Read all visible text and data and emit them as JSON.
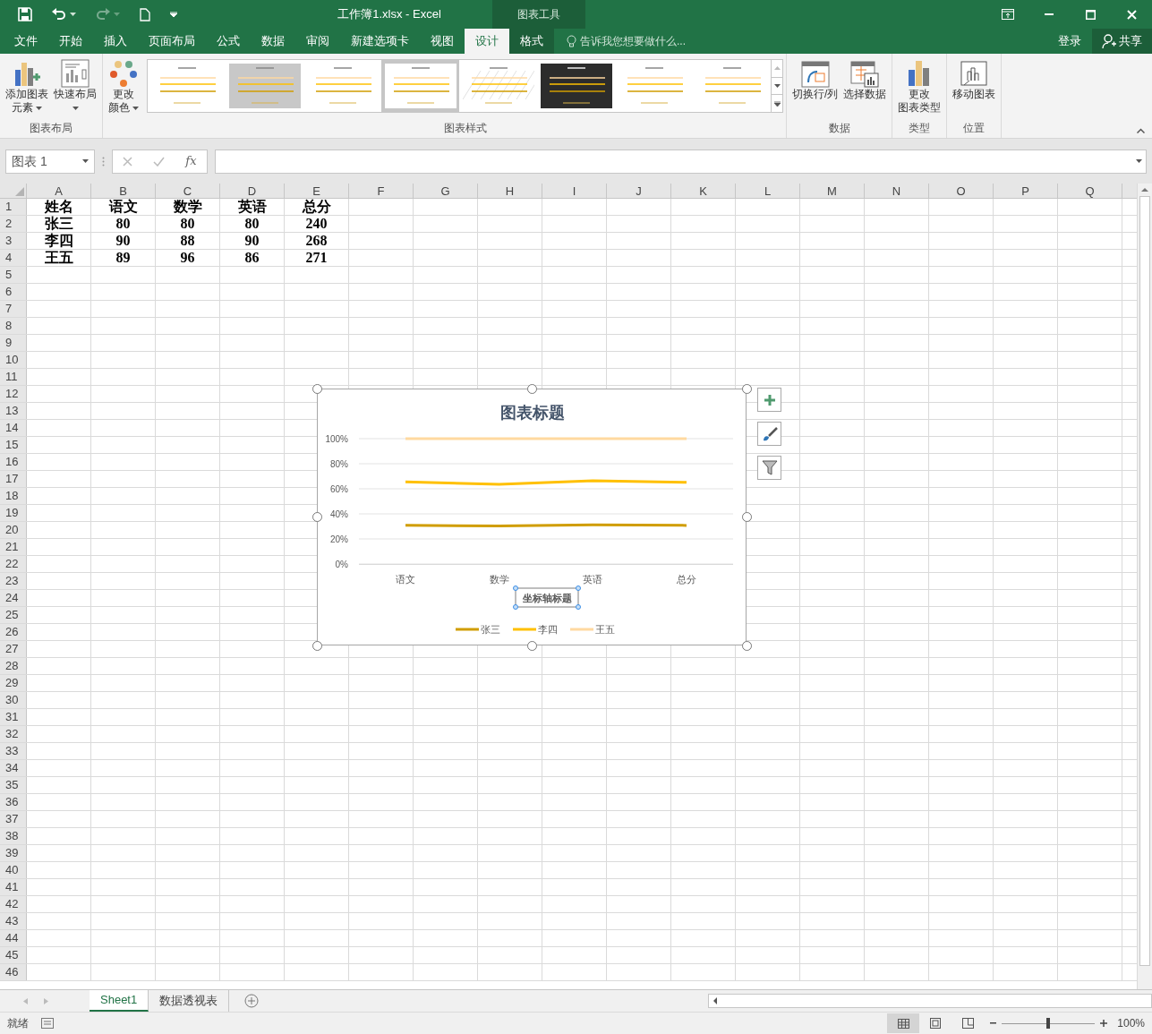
{
  "window": {
    "title": "工作簿1.xlsx - Excel",
    "context_group": "图表工具"
  },
  "ribbon_tabs": [
    {
      "label": "文件",
      "selected": false
    },
    {
      "label": "开始",
      "selected": false
    },
    {
      "label": "插入",
      "selected": false
    },
    {
      "label": "页面布局",
      "selected": false
    },
    {
      "label": "公式",
      "selected": false
    },
    {
      "label": "数据",
      "selected": false
    },
    {
      "label": "审阅",
      "selected": false
    },
    {
      "label": "新建选项卡",
      "selected": false
    },
    {
      "label": "视图",
      "selected": false
    },
    {
      "label": "设计",
      "selected": true,
      "kind": "context"
    },
    {
      "label": "格式",
      "selected": false,
      "kind": "context"
    }
  ],
  "tell_me": {
    "placeholder": "告诉我您想要做什么..."
  },
  "account": {
    "sign_in": "登录",
    "share": "共享"
  },
  "ribbon_groups": [
    {
      "label": "图表布局",
      "buttons": [
        {
          "kind": "add-element",
          "lines": [
            "添加图表",
            "元素"
          ],
          "dropdown": true
        },
        {
          "kind": "quick-layout",
          "lines": [
            "快速布局"
          ],
          "dropdown": true
        }
      ]
    },
    {
      "buttons": [
        {
          "kind": "colors",
          "lines": [
            "更改",
            "颜色"
          ],
          "dropdown": true
        }
      ]
    },
    {
      "label": "图表样式",
      "kind": "gallery",
      "styles": [
        {
          "kind": "light",
          "selected": false
        },
        {
          "kind": "gray",
          "selected": false
        },
        {
          "kind": "light",
          "selected": false
        },
        {
          "kind": "light",
          "selected": true
        },
        {
          "kind": "hatched",
          "selected": false
        },
        {
          "kind": "dark",
          "selected": false
        },
        {
          "kind": "light",
          "selected": false
        },
        {
          "kind": "light",
          "selected": false
        }
      ]
    },
    {
      "label": "数据",
      "buttons": [
        {
          "kind": "switch",
          "lines": [
            "切换行/列"
          ],
          "dropdown": false
        },
        {
          "kind": "select-data",
          "lines": [
            "选择数据"
          ],
          "dropdown": false
        }
      ]
    },
    {
      "label": "类型",
      "buttons": [
        {
          "kind": "chart-type",
          "lines": [
            "更改",
            "图表类型"
          ],
          "dropdown": false
        }
      ]
    },
    {
      "label": "位置",
      "buttons": [
        {
          "kind": "move",
          "lines": [
            "移动图表"
          ],
          "dropdown": false
        }
      ]
    }
  ],
  "formula_bar": {
    "name_box": "图表 1",
    "function_label": "fx"
  },
  "sheet": {
    "columns": [
      "A",
      "B",
      "C",
      "D",
      "E",
      "F",
      "G",
      "H",
      "I",
      "J",
      "K",
      "L",
      "M",
      "N",
      "O",
      "P",
      "Q"
    ],
    "rows": [
      "1",
      "2",
      "3",
      "4",
      "5",
      "6",
      "7",
      "8",
      "9",
      "10",
      "11",
      "12",
      "13",
      "14",
      "15",
      "16",
      "17",
      "18",
      "19",
      "20",
      "21",
      "22",
      "23",
      "24",
      "25",
      "26",
      "27",
      "28",
      "29",
      "30",
      "31",
      "32",
      "33",
      "34",
      "35",
      "36",
      "37",
      "38",
      "39",
      "40",
      "41",
      "42",
      "43",
      "44",
      "45",
      "46"
    ],
    "cells": [
      [
        "姓名",
        "语文",
        "数学",
        "英语",
        "总分"
      ],
      [
        "张三",
        "80",
        "80",
        "80",
        "240"
      ],
      [
        "李四",
        "90",
        "88",
        "90",
        "268"
      ],
      [
        "王五",
        "89",
        "96",
        "86",
        "271"
      ]
    ]
  },
  "chart": {
    "chart_data": {
      "type": "line",
      "grid": true,
      "legend": "bottom",
      "title": "图表标题",
      "xlabel": "坐标轴标题",
      "categories": [
        "语文",
        "数学",
        "英语",
        "总分"
      ],
      "series": [
        {
          "name": "张三",
          "color": "#d09d00",
          "values": [
            0.309,
            0.303,
            0.313,
            0.308
          ]
        },
        {
          "name": "李四",
          "color": "#ffc000",
          "values": [
            0.656,
            0.636,
            0.664,
            0.652
          ]
        },
        {
          "name": "王五",
          "color": "#ffd9a0",
          "values": [
            1,
            1,
            1,
            1
          ]
        }
      ],
      "ylim": [
        0,
        1
      ],
      "yticks": [
        {
          "value": 0,
          "label": "0%"
        },
        {
          "value": 0.2,
          "label": "20%"
        },
        {
          "value": 0.4,
          "label": "40%"
        },
        {
          "value": 0.6,
          "label": "60%"
        },
        {
          "value": 0.8,
          "label": "80%"
        },
        {
          "value": 1,
          "label": "100%"
        }
      ]
    }
  },
  "sheet_tabs": [
    {
      "label": "Sheet1",
      "selected": true
    },
    {
      "label": "数据透视表",
      "selected": false
    }
  ],
  "status_bar": {
    "status": "就绪",
    "zoom": "100%",
    "level": 0.5
  }
}
